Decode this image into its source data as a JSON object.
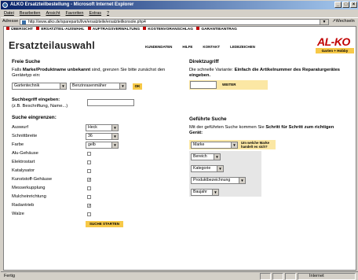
{
  "window": {
    "title": "ALKO Ersatzteilbestellung - Microsoft Internet Explorer"
  },
  "menu": [
    "Datei",
    "Bearbeiten",
    "Ansicht",
    "Favoriten",
    "Extras",
    "?"
  ],
  "address": {
    "label": "Adresse",
    "url": "http://www.alko.de/spareparts/live/ersatzteile/ersatzteilkonsole.php4",
    "go": "Wechseln zu"
  },
  "nav": [
    "ÜBERSICHT",
    "ERSATZTEIL-AUSWAHL",
    "AUFTRAGSVERWALTUNG",
    "KOSTENVORANSCHLAG",
    "GARANTIEANTRAG"
  ],
  "page_title": "Ersatzteilauswahl",
  "tabs": [
    "KUNDENDATEN",
    "HILFE",
    "KONTAKT",
    "LEDEZEICHEN"
  ],
  "logo": {
    "text": "AL-KO",
    "sub": "Garten + Hobby"
  },
  "free_search": {
    "title": "Freie Suche",
    "intro_pre": "Falls ",
    "intro_bold": "Marke/Produktname unbekannt",
    "intro_post": " sind, grenzen Sie bitte zunächst den Gerätetyp ein:",
    "select1": "Gartentechnik",
    "select2": "Benzinrasenmäher",
    "ok": "OK",
    "keyword_label": "Suchbegriff eingeben:",
    "keyword_hint": "(z.B. Beschriftung, Name...)",
    "narrow_title": "Suche eingrenzen:",
    "filters": [
      {
        "label": "Auswurf",
        "value": "Heck"
      },
      {
        "label": "Schnittbreite",
        "value": "36"
      },
      {
        "label": "Farbe",
        "value": "gelb"
      }
    ],
    "checks": [
      {
        "label": "Alu-Gehäuse",
        "checked": false
      },
      {
        "label": "Elektrostart",
        "checked": false
      },
      {
        "label": "Katalysator",
        "checked": false
      },
      {
        "label": "Kunststoff-Gehäuse",
        "checked": true
      },
      {
        "label": "Messerkupplung",
        "checked": false
      },
      {
        "label": "Mulcheinrichtung",
        "checked": false
      },
      {
        "label": "Radantrieb",
        "checked": true
      },
      {
        "label": "Walze",
        "checked": false
      }
    ],
    "start": "SUCHE STARTEN"
  },
  "direct": {
    "title": "Direktzugriff",
    "text_pre": "Die schnelle Variante: ",
    "text_bold": "Einfach die Artikelnummer des Reparaturgerätes eingeben.",
    "button": "WEITER"
  },
  "guided": {
    "title": "Geführte Suche",
    "text_pre": "Mit der geführten Suche kommen Sie ",
    "text_bold": "Schritt für Schritt zum richtigen Gerät:",
    "brand": "Marke",
    "brand_hint": "Um welche Marke handelt es sich?",
    "steps": [
      "Bereich",
      "Kategorie",
      "Produktbezeichnung",
      "Baujahr"
    ]
  },
  "status": {
    "left": "Fertig",
    "zone": "Internet"
  }
}
